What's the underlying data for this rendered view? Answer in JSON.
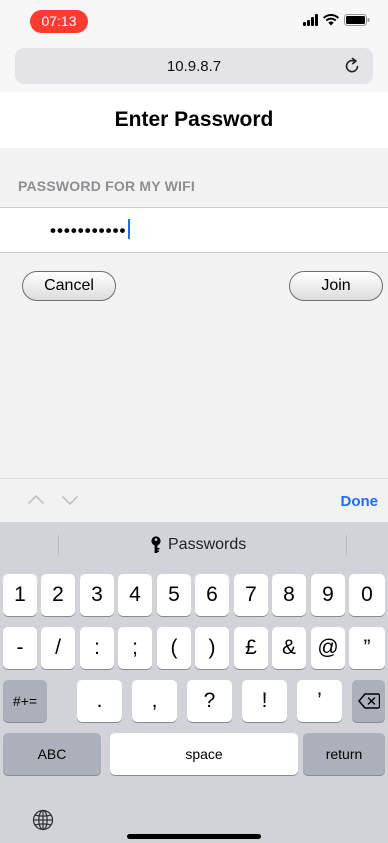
{
  "status_bar": {
    "time": "07:13"
  },
  "browser": {
    "url": "10.9.8.7",
    "reload_icon": "reload-icon"
  },
  "page": {
    "title": "Enter Password",
    "section_label": "PASSWORD FOR MY WIFI",
    "password_masked": "•••••••••••",
    "cancel_label": "Cancel",
    "join_label": "Join"
  },
  "accessory": {
    "done_label": "Done",
    "icons": [
      "chevron-up-icon",
      "chevron-down-icon"
    ]
  },
  "keyboard": {
    "suggestion": "Passwords",
    "row1": [
      "1",
      "2",
      "3",
      "4",
      "5",
      "6",
      "7",
      "8",
      "9",
      "0"
    ],
    "row2": [
      "-",
      "/",
      ":",
      ";",
      "(",
      ")",
      "£",
      "&",
      "@",
      "”"
    ],
    "row3_mod": "#+=",
    "row3": [
      ".",
      ",",
      "?",
      "!",
      "’"
    ],
    "abc_label": "ABC",
    "space_label": "space",
    "return_label": "return",
    "icons": [
      "key-icon",
      "delete-icon",
      "globe-icon"
    ]
  },
  "colors": {
    "accent": "#1f6bff",
    "time_pill": "#ff3b30",
    "keyboard_bg": "#d1d3d9"
  }
}
